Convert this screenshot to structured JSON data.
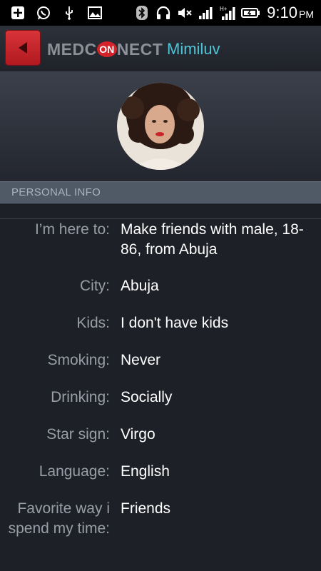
{
  "status_bar": {
    "icons": [
      "plus-box-icon",
      "whatsapp-icon",
      "usb-icon",
      "image-icon",
      "bluetooth-icon",
      "headphones-icon",
      "mute-icon",
      "signal-icon",
      "hplus-signal-icon",
      "battery-icon"
    ],
    "time": "9:10",
    "ampm": "PM"
  },
  "header": {
    "logo_part1": "MEDC",
    "logo_on": "ON",
    "logo_part2": "NECT",
    "username": "Mimiluv"
  },
  "section": {
    "title": "PERSONAL INFO"
  },
  "info_rows": [
    {
      "label": "I’m here to:",
      "value": "Make friends with male, 18-86, from Abuja"
    },
    {
      "label": "City:",
      "value": "Abuja"
    },
    {
      "label": "Kids:",
      "value": "I don't have kids"
    },
    {
      "label": "Smoking:",
      "value": "Never"
    },
    {
      "label": "Drinking:",
      "value": "Socially"
    },
    {
      "label": "Star sign:",
      "value": "Virgo"
    },
    {
      "label": "Language:",
      "value": "English"
    },
    {
      "label": "Favorite way i spend my time:",
      "value": "Friends"
    }
  ],
  "colors": {
    "accent": "#4ec6d8",
    "back_button": "#c9252c",
    "background": "#1e2027"
  }
}
